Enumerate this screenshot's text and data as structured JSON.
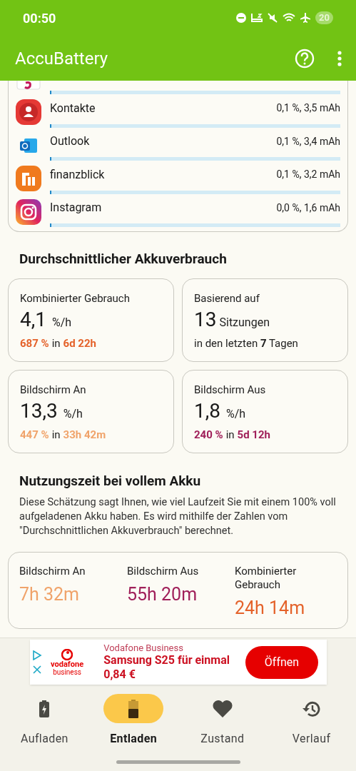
{
  "status_bar": {
    "time": "00:50",
    "battery": "20"
  },
  "app_bar": {
    "title": "AccuBattery"
  },
  "apps": [
    {
      "kind": "partial",
      "level": 0.005
    },
    {
      "kind": "app",
      "name": "Kontakte",
      "usage": "0,1 %, 3,5 mAh",
      "level": 0.005
    },
    {
      "kind": "app",
      "name": "Outlook",
      "usage": "0,1 %, 3,4 mAh",
      "level": 0.005
    },
    {
      "kind": "app",
      "name": "finanzblick",
      "usage": "0,1 %, 3,2 mAh",
      "level": 0.005
    },
    {
      "kind": "app",
      "name": "Instagram",
      "usage": "0,0 %, 1,6 mAh",
      "level": 0.004
    }
  ],
  "average": {
    "title": "Durchschnittlicher Akkuverbrauch",
    "cards": [
      {
        "kind": "rate",
        "label": "Kombinierter Gebrauch",
        "value": "4,1",
        "unit": "%/h",
        "amount": "687 %",
        "joiner": "in",
        "duration": "6d 22h",
        "color": "#e4622a"
      },
      {
        "kind": "sessions",
        "label": "Basierend auf",
        "value": "13",
        "unit": "Sitzungen",
        "note": "in den letzten **7** Tagen"
      },
      {
        "kind": "rate",
        "label": "Bildschirm An",
        "value": "13,3",
        "unit": "%/h",
        "amount": "447 %",
        "joiner": "in",
        "duration": "33h 42m",
        "color": "#f0a36a"
      },
      {
        "kind": "rate",
        "label": "Bildschirm Aus",
        "value": "1,8",
        "unit": "%/h",
        "amount": "240 %",
        "joiner": "in",
        "duration": "5d 12h",
        "color": "#a0205a"
      }
    ]
  },
  "full_charge": {
    "title": "Nutzungszeit bei vollem Akku",
    "description": "Diese Schätzung sagt Ihnen, wie viel Laufzeit Sie mit einem 100% voll aufgeladenen Akku haben. Es wird mithilfe der Zahlen vom \"Durchschnittlichen Akkuverbrauch\" berechnet.",
    "items": [
      {
        "label": "Bildschirm An",
        "value": "7h 32m",
        "color": "#f0a36a"
      },
      {
        "label": "Bildschirm Aus",
        "value": "55h 20m",
        "color": "#a0205a"
      },
      {
        "label": "Kombinierter Gebrauch",
        "value": "24h 14m",
        "color": "#e4622a"
      }
    ]
  },
  "ad": {
    "logo_top": "vodafone",
    "logo_bottom": "business",
    "advertiser": "Vodafone Business",
    "headline": "Samsung S25 für einmal 0,84 €",
    "button": "Öffnen"
  },
  "nav": [
    {
      "label": "Aufladen",
      "selected": false
    },
    {
      "label": "Entladen",
      "selected": true
    },
    {
      "label": "Zustand",
      "selected": false
    },
    {
      "label": "Verlauf",
      "selected": false
    }
  ]
}
